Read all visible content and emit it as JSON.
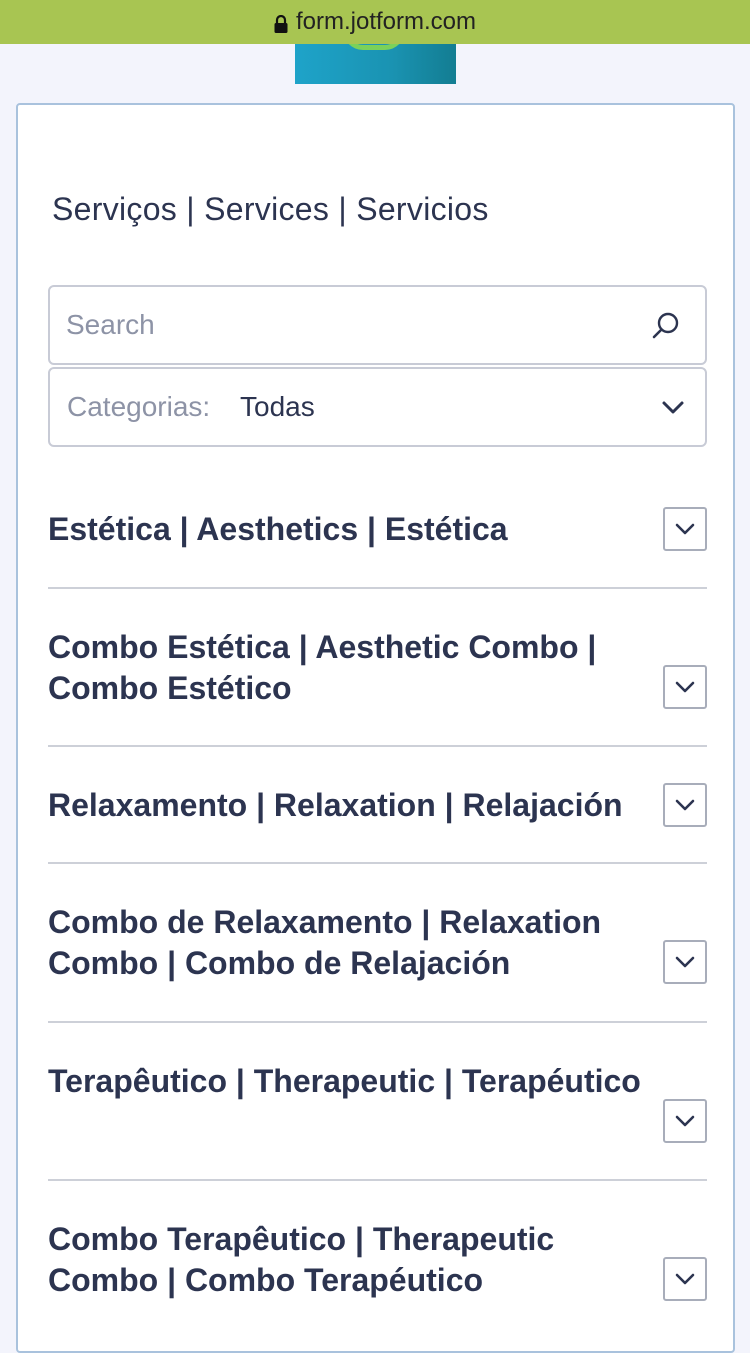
{
  "browser": {
    "url": "form.jotform.com"
  },
  "form": {
    "title": "Serviços | Services | Servicios",
    "search": {
      "placeholder": "Search",
      "value": ""
    },
    "category_filter": {
      "label": "Categorias:",
      "selected": "Todas"
    },
    "categories": [
      {
        "title": "Estética | Aesthetics | Estética"
      },
      {
        "title": "Combo Estética | Aesthetic Combo | Combo Estético"
      },
      {
        "title": "Relaxamento | Relaxation | Relajación"
      },
      {
        "title": "Combo de Relaxamento | Relaxation Combo | Combo de Relajación"
      },
      {
        "title": "Terapêutico | Therapeutic | Terapéutico"
      },
      {
        "title": "Combo Terapêutico | Therapeutic Combo | Combo Terapéutico"
      }
    ]
  },
  "colors": {
    "url_bar": "#a8c552",
    "page_bg": "#f3f4fc",
    "text": "#2c3450",
    "card_border": "#a9c2dd"
  }
}
